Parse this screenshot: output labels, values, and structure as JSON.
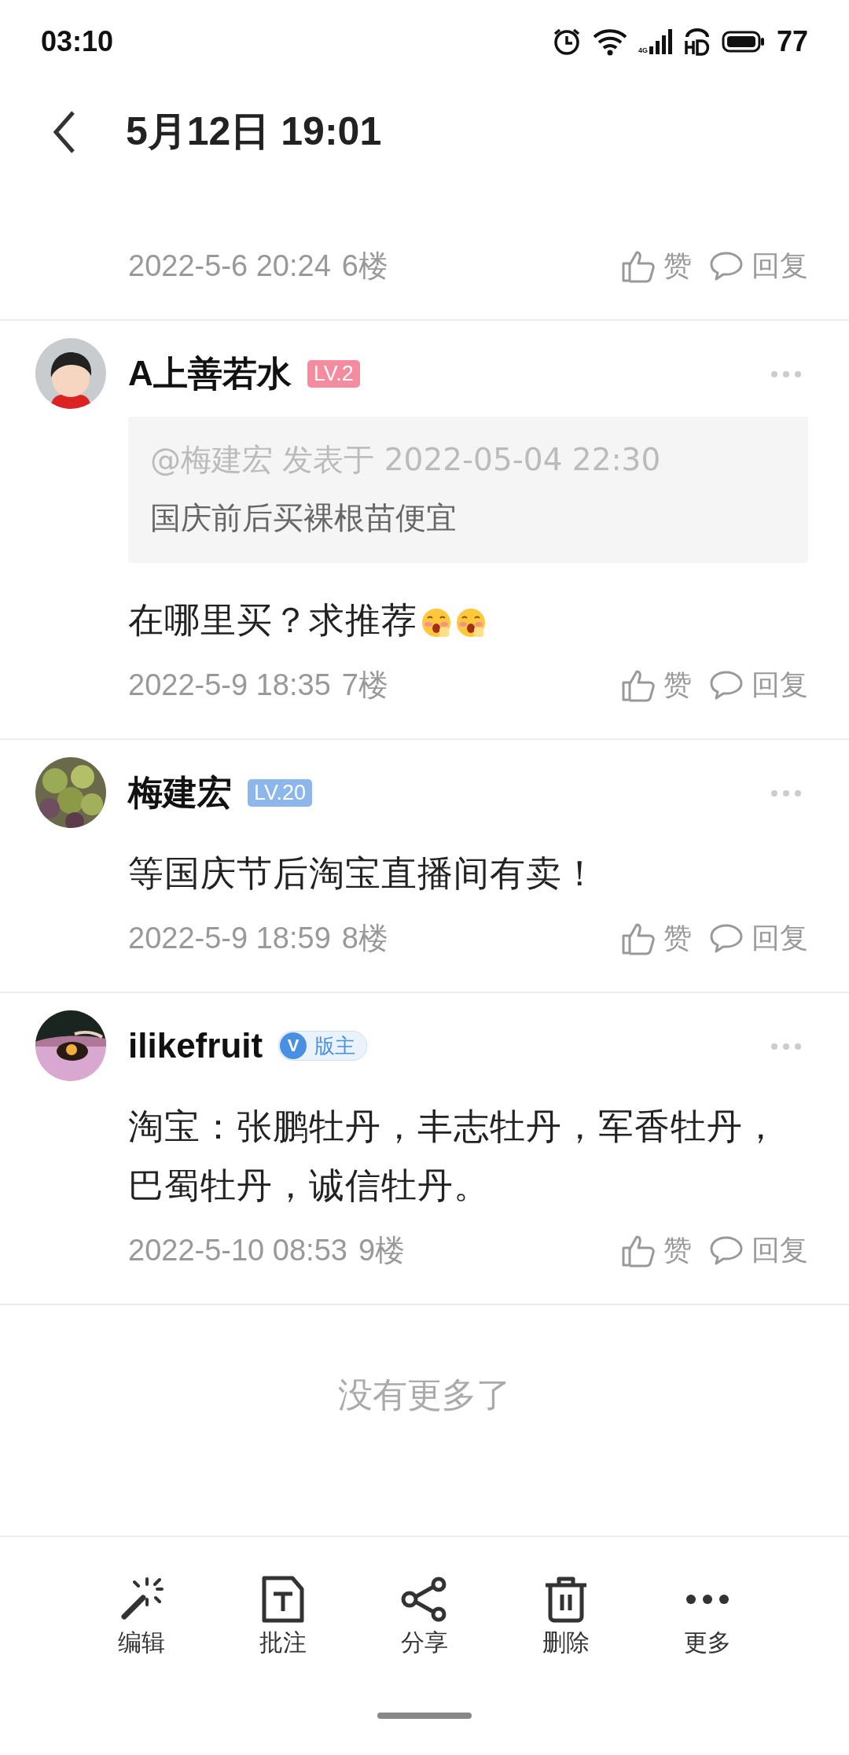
{
  "status_bar": {
    "time": "03:10",
    "network": "4G",
    "battery": "77"
  },
  "header": {
    "title": "5月12日 19:01"
  },
  "comments": [
    {
      "time": "2022-5-6 20:24",
      "floor": "6楼",
      "like": "赞",
      "reply": "回复"
    },
    {
      "name": "A上善若水",
      "avatar": {
        "kind": "cartoon"
      },
      "badge": {
        "kind": "level",
        "text": "LV.2",
        "color": "#f48ca0"
      },
      "quote": {
        "meta": "@梅建宏 发表于 2022-05-04 22:30",
        "text": "国庆前后买裸根苗便宜"
      },
      "body": [
        {
          "kind": "text",
          "text": "在哪里买？求推荐"
        },
        {
          "kind": "sticker"
        },
        {
          "kind": "sticker"
        }
      ],
      "time": "2022-5-9 18:35",
      "floor": "7楼",
      "like": "赞",
      "reply": "回复"
    },
    {
      "name": "梅建宏",
      "badge": {
        "kind": "level",
        "text": "LV.20",
        "color": "#8db6ea"
      },
      "body": [
        {
          "kind": "text",
          "text": "等国庆节后淘宝直播间有卖！"
        }
      ],
      "time": "2022-5-9 18:59",
      "floor": "8楼",
      "like": "赞",
      "reply": "回复"
    },
    {
      "name": "ilikefruit",
      "badge": {
        "kind": "moderator",
        "text": "版主",
        "mark": "V",
        "color": "#4a90e2"
      },
      "body": [
        {
          "kind": "text",
          "text": "淘宝：张鹏牡丹，丰志牡丹，军香牡丹，巴蜀牡丹，诚信牡丹。"
        }
      ],
      "time": "2022-5-10 08:53",
      "floor": "9楼",
      "like": "赞",
      "reply": "回复"
    }
  ],
  "end_note": "没有更多了",
  "toolbar": [
    {
      "kind": "edit",
      "label": "编辑"
    },
    {
      "kind": "annotate",
      "label": "批注"
    },
    {
      "kind": "share",
      "label": "分享"
    },
    {
      "kind": "delete",
      "label": "删除"
    },
    {
      "kind": "more",
      "label": "更多"
    }
  ]
}
